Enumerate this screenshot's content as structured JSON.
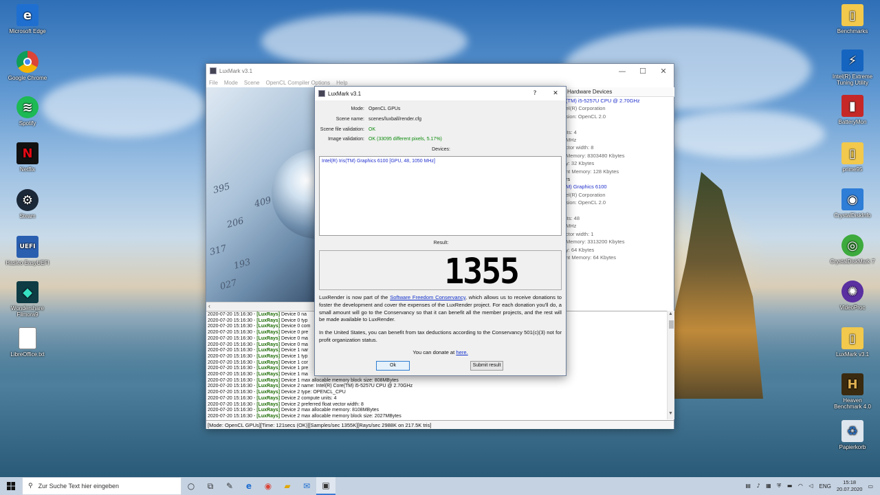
{
  "desktop_icons_left": [
    "Microsoft Edge",
    "Google Chrome",
    "Spotify",
    "Netflix",
    "Steam",
    "Hasleo EasyUEFI",
    "Wondershare Filmora9",
    "LibreOffice.txt"
  ],
  "desktop_icons_right": [
    "Benchmarks",
    "Intel(R) Extreme Tuning Utility",
    "BatteryMon",
    "prime95",
    "CrystalDiskInfo",
    "CrystalDiskMark 7",
    "VideoProc",
    "LuxMark v3.1",
    "Heaven Benchmark 4.0",
    "Papierkorb"
  ],
  "main_window": {
    "title": "LuxMark v3.1",
    "menu": [
      "File",
      "Mode",
      "Scene",
      "OpenCL Compiler Options",
      "Help"
    ],
    "hardware_tab": "Hardware Devices",
    "hardware_lines": [
      {
        "text": "(TM) i5-5257U CPU @ 2.70GHz",
        "style": "blue"
      },
      {
        "text": "el(R) Corporation",
        "style": ""
      },
      {
        "text": "sion: OpenCL 2.0",
        "style": ""
      },
      {
        "text": "",
        "style": ""
      },
      {
        "text": "its: 4",
        "style": ""
      },
      {
        "text": "MHz",
        "style": ""
      },
      {
        "text": "ctor width: 8",
        "style": ""
      },
      {
        "text": "Memory: 8303480 Kbytes",
        "style": ""
      },
      {
        "text": "y: 32 Kbytes",
        "style": ""
      },
      {
        "text": "nt Memory: 128 Kbytes",
        "style": ""
      },
      {
        "text": "rs",
        "style": "dark"
      },
      {
        "text": "M) Graphics 6100",
        "style": "blue"
      },
      {
        "text": "el(R) Corporation",
        "style": ""
      },
      {
        "text": "sion: OpenCL 2.0",
        "style": ""
      },
      {
        "text": "",
        "style": ""
      },
      {
        "text": "its: 48",
        "style": ""
      },
      {
        "text": "MHz",
        "style": ""
      },
      {
        "text": "ctor width: 1",
        "style": ""
      },
      {
        "text": "Memory: 3313200 Kbytes",
        "style": ""
      },
      {
        "text": "y: 64 Kbytes",
        "style": ""
      },
      {
        "text": "nt Memory: 64 Kbytes",
        "style": ""
      }
    ],
    "log_lines": [
      {
        "time": "2020-07-20 15:16:30 - ",
        "tag": "[LuxRays]",
        "msg": " Device 0 na"
      },
      {
        "time": "2020-07-20 15:16:30 - ",
        "tag": "[LuxRays]",
        "msg": " Device 0 typ"
      },
      {
        "time": "2020-07-20 15:16:30 - ",
        "tag": "[LuxRays]",
        "msg": " Device 0 com"
      },
      {
        "time": "2020-07-20 15:16:30 - ",
        "tag": "[LuxRays]",
        "msg": " Device 0 pre"
      },
      {
        "time": "2020-07-20 15:16:30 - ",
        "tag": "[LuxRays]",
        "msg": " Device 0 ma"
      },
      {
        "time": "2020-07-20 15:16:30 - ",
        "tag": "[LuxRays]",
        "msg": " Device 0 ma"
      },
      {
        "time": "2020-07-20 15:16:30 - ",
        "tag": "[LuxRays]",
        "msg": " Device 1 nar"
      },
      {
        "time": "2020-07-20 15:16:30 - ",
        "tag": "[LuxRays]",
        "msg": " Device 1 typ"
      },
      {
        "time": "2020-07-20 15:16:30 - ",
        "tag": "[LuxRays]",
        "msg": " Device 1 cor"
      },
      {
        "time": "2020-07-20 15:16:30 - ",
        "tag": "[LuxRays]",
        "msg": " Device 1 pre"
      },
      {
        "time": "2020-07-20 15:16:30 - ",
        "tag": "[LuxRays]",
        "msg": " Device 1 ma"
      },
      {
        "time": "2020-07-20 15:16:30 - ",
        "tag": "[LuxRays]",
        "msg": " Device 1 max allocable memory block size: 808MBytes"
      },
      {
        "time": "2020-07-20 15:16:30 - ",
        "tag": "[LuxRays]",
        "msg": " Device 2 name: Intel(R) Core(TM) i5-5257U CPU @ 2.70GHz"
      },
      {
        "time": "2020-07-20 15:16:30 - ",
        "tag": "[LuxRays]",
        "msg": " Device 2 type: OPENCL_CPU"
      },
      {
        "time": "2020-07-20 15:16:30 - ",
        "tag": "[LuxRays]",
        "msg": " Device 2 compute units: 4"
      },
      {
        "time": "2020-07-20 15:16:30 - ",
        "tag": "[LuxRays]",
        "msg": " Device 2 preferred float vector width: 8"
      },
      {
        "time": "2020-07-20 15:16:30 - ",
        "tag": "[LuxRays]",
        "msg": " Device 2 max allocable memory: 8108MBytes"
      },
      {
        "time": "2020-07-20 15:16:30 - ",
        "tag": "[LuxRays]",
        "msg": " Device 2 max allocable memory block size: 2027MBytes"
      }
    ],
    "status": "[Mode: OpenCL GPUs][Time: 121secs (OK)][Samples/sec   1355K][Rays/sec   2988K on 217.5K tris]"
  },
  "dialog": {
    "title": "LuxMark v3.1",
    "help": "?",
    "close": "✕",
    "mode_label": "Mode:",
    "mode_value": "OpenCL GPUs",
    "scene_label": "Scene name:",
    "scene_value": "scenes/luxball/render.cfg",
    "scene_valid_label": "Scene file validation:",
    "scene_valid_value": "OK",
    "image_valid_label": "Image validation:",
    "image_valid_value": "OK (33095 different pixels, 5.17%)",
    "devices_label": "Devices:",
    "device": "Intel(R) Iris(TM) Graphics 6100 [GPU, 48, 1050 MHz]",
    "result_label": "Result:",
    "result": "1355",
    "para1_a": "LuxRender is now part of the ",
    "para1_link": "Software Freedom Conservancy",
    "para1_b": ", which allows us to receive donations to foster the development and cover the expenses of the LuxRender project. For each donation you'll do, a small amount will go to the Conservancy so that it can benefit all the member projects, and the rest will be made available to LuxRender.",
    "para2": "In the United States, you can benefit from tax deductions according to the Conservancy 501(c)(3) not for profit organization status.",
    "donate_a": "You can donate at ",
    "donate_link": "here.",
    "ok": "Ok",
    "submit": "Submit result"
  },
  "taskbar": {
    "search_placeholder": "Zur Suche Text hier eingeben",
    "lang": "ENG",
    "time": "15:18",
    "date": "20.07.2020"
  }
}
